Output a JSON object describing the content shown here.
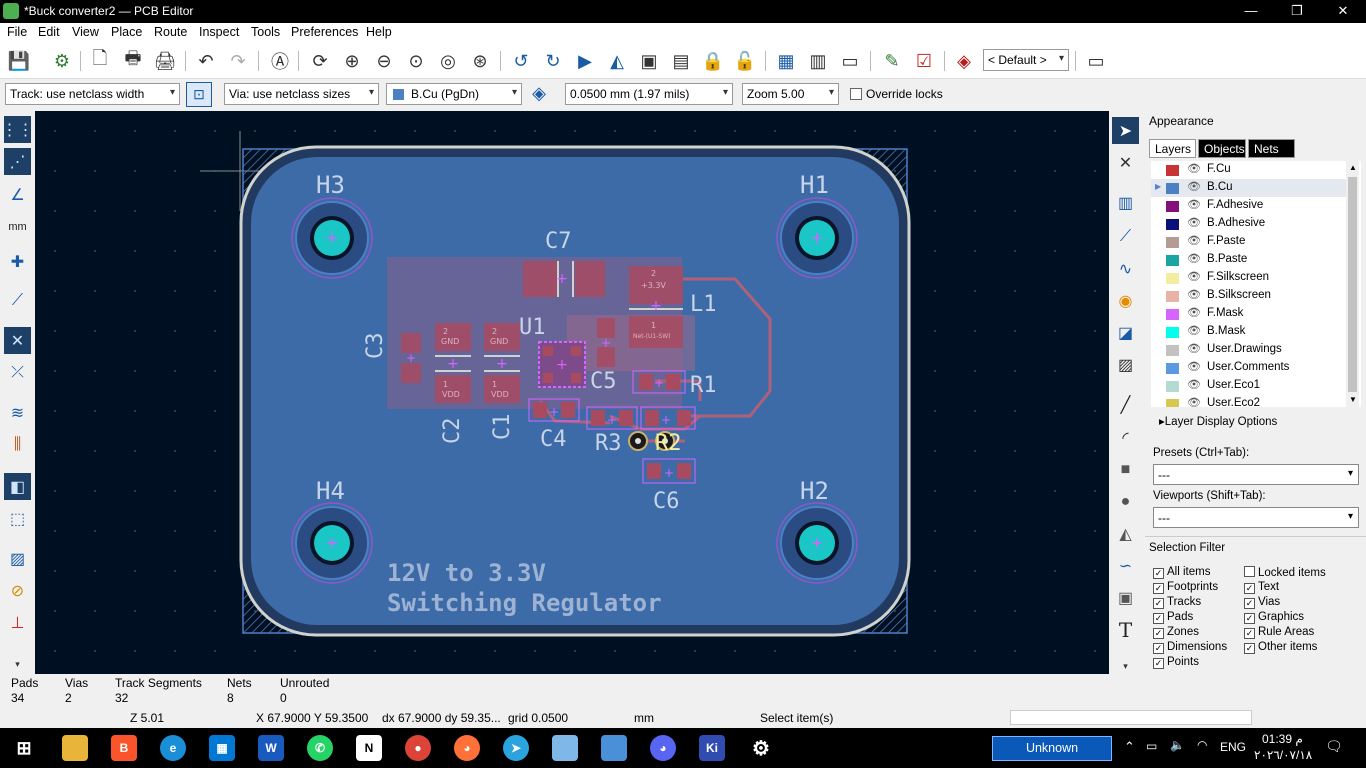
{
  "window": {
    "title": "*Buck converter2 — PCB Editor",
    "minimize": "—",
    "maximize": "❐",
    "close": "✕"
  },
  "menu": [
    "File",
    "Edit",
    "View",
    "Place",
    "Route",
    "Inspect",
    "Tools",
    "Preferences",
    "Help"
  ],
  "toolbar": {
    "icons": [
      "save-icon",
      "board-setup-icon",
      "page-settings-icon",
      "print-icon",
      "plot-icon",
      "undo-icon",
      "redo-icon",
      "find-icon",
      "refresh-icon",
      "zoom-in-icon",
      "zoom-out-icon",
      "zoom-fit-icon",
      "zoom-objects-icon",
      "zoom-selection-icon",
      "rotate-ccw-icon",
      "rotate-cw-icon",
      "flip-icon",
      "mirror-icon",
      "group-icon",
      "ungroup-icon",
      "lock-icon",
      "unlock-icon",
      "netlist-icon",
      "footprint-editor-icon",
      "footprint-browser-icon",
      "scripting-icon",
      "drc-icon",
      "layer-pair-icon",
      "terminal-icon"
    ],
    "layer_preset": "< Default >"
  },
  "track_toolbar": {
    "track": "Track: use netclass width",
    "via": "Via: use netclass sizes",
    "layer": "B.Cu (PgDn)",
    "layer_color": "#4d7fc4",
    "grid": "0.0500 mm (1.97 mils)",
    "zoom": "Zoom 5.00",
    "override_locks": "Override locks"
  },
  "left_tools": [
    "grid-icon",
    "grid-overrides-icon",
    "polar-coords-icon",
    "units-icon",
    "cursor-icon",
    "graphics-icon",
    "ratsnest-icon",
    "curved-ratsnest-icon",
    "tracks-icon",
    "vias-icon",
    "pads-icon",
    "net-inspector-icon",
    "zone-outline-icon",
    "highlight-net-icon",
    "show-layers-icon",
    "microwave-icon"
  ],
  "right_tools": [
    "select-icon",
    "local-ratsnest-icon",
    "footprint-icon",
    "route-track-icon",
    "tune-length-icon",
    "via-icon",
    "zone-icon",
    "rule-area-icon",
    "line-icon",
    "arc-icon",
    "rectangle-icon",
    "circle-icon",
    "polygon-icon",
    "bezier-icon",
    "image-icon",
    "text-icon"
  ],
  "board": {
    "labels": {
      "h1": "H1",
      "h2": "H2",
      "h3": "H3",
      "h4": "H4",
      "c2": "C2",
      "c1": "C1",
      "c3": "C3",
      "c4": "C4",
      "c5": "C5",
      "c6": "C6",
      "c7": "C7",
      "u1": "U1",
      "l1": "L1",
      "r1": "R1",
      "r2": "R2",
      "r3": "R3"
    },
    "pads": {
      "gnd": "GND",
      "vdd": "VDD",
      "v33": "+3.3V",
      "one": "1",
      "two": "2",
      "net_l1": "Net-(U1-SW)"
    },
    "silk_line1": "12V to 3.3V",
    "silk_line2": "Switching Regulator"
  },
  "appearance": {
    "title": "Appearance",
    "tabs": [
      "Layers",
      "Objects",
      "Nets"
    ],
    "layers": [
      {
        "name": "F.Cu",
        "color": "#c83434"
      },
      {
        "name": "B.Cu",
        "color": "#4d7fc4",
        "selected": true
      },
      {
        "name": "F.Adhesive",
        "color": "#84117a"
      },
      {
        "name": "B.Adhesive",
        "color": "#0a0f7a"
      },
      {
        "name": "F.Paste",
        "color": "#b49b95"
      },
      {
        "name": "B.Paste",
        "color": "#1aa4a4"
      },
      {
        "name": "F.Silkscreen",
        "color": "#f2eda1"
      },
      {
        "name": "B.Silkscreen",
        "color": "#e8b2a7"
      },
      {
        "name": "F.Mask",
        "color": "#d864ff"
      },
      {
        "name": "B.Mask",
        "color": "#02ffee"
      },
      {
        "name": "User.Drawings",
        "color": "#c2c2c2"
      },
      {
        "name": "User.Comments",
        "color": "#5b9ae0"
      },
      {
        "name": "User.Eco1",
        "color": "#b4dbd2"
      },
      {
        "name": "User.Eco2",
        "color": "#d8c852"
      }
    ],
    "layer_display_options": "Layer Display Options",
    "presets_label": "Presets (Ctrl+Tab):",
    "presets_value": "---",
    "viewports_label": "Viewports (Shift+Tab):",
    "viewports_value": "---"
  },
  "selection_filter": {
    "title": "Selection Filter",
    "left": [
      {
        "label": "All items",
        "checked": true
      },
      {
        "label": "Footprints",
        "checked": true
      },
      {
        "label": "Tracks",
        "checked": true
      },
      {
        "label": "Pads",
        "checked": true
      },
      {
        "label": "Zones",
        "checked": true
      },
      {
        "label": "Dimensions",
        "checked": true
      },
      {
        "label": "Points",
        "checked": true
      }
    ],
    "right": [
      {
        "label": "Locked items",
        "checked": false
      },
      {
        "label": "Text",
        "checked": true
      },
      {
        "label": "Vias",
        "checked": true
      },
      {
        "label": "Graphics",
        "checked": true
      },
      {
        "label": "Rule Areas",
        "checked": true
      },
      {
        "label": "Other items",
        "checked": true
      }
    ]
  },
  "messages": [
    {
      "label": "Pads",
      "value": "34"
    },
    {
      "label": "Vias",
      "value": "2"
    },
    {
      "label": "Track Segments",
      "value": "32"
    },
    {
      "label": "Nets",
      "value": "8"
    },
    {
      "label": "Unrouted",
      "value": "0"
    }
  ],
  "status": {
    "zoom": "Z 5.01",
    "xy": "X 67.9000  Y 59.3500",
    "dxdy": "dx 67.9000  dy 59.35...",
    "grid": "grid 0.0500",
    "units": "mm",
    "action": "Select item(s)"
  },
  "taskbar": {
    "apps": [
      "windows-start-icon",
      "file-explorer-icon",
      "brave-icon",
      "edge-icon",
      "store-icon",
      "word-icon",
      "whatsapp-icon",
      "notion-icon",
      "chrome-icon",
      "firefox-icon",
      "telegram-icon",
      "notepad-icon",
      "photos-icon",
      "discord-icon",
      "kicad-icon",
      "settings-icon"
    ],
    "unknown_button": "Unknown",
    "lang": "ENG",
    "time": "01:39 م",
    "date": "٢٠٢٦/٠٧/١٨"
  },
  "colors": {
    "canvas_bg": "#001023",
    "board_fill": "#3c6ba8",
    "edge_cuts": "#d0d2cd",
    "silk": "#c8d4e8",
    "pad_red": "#a84a60",
    "via_cyan": "#1ac6c6"
  }
}
